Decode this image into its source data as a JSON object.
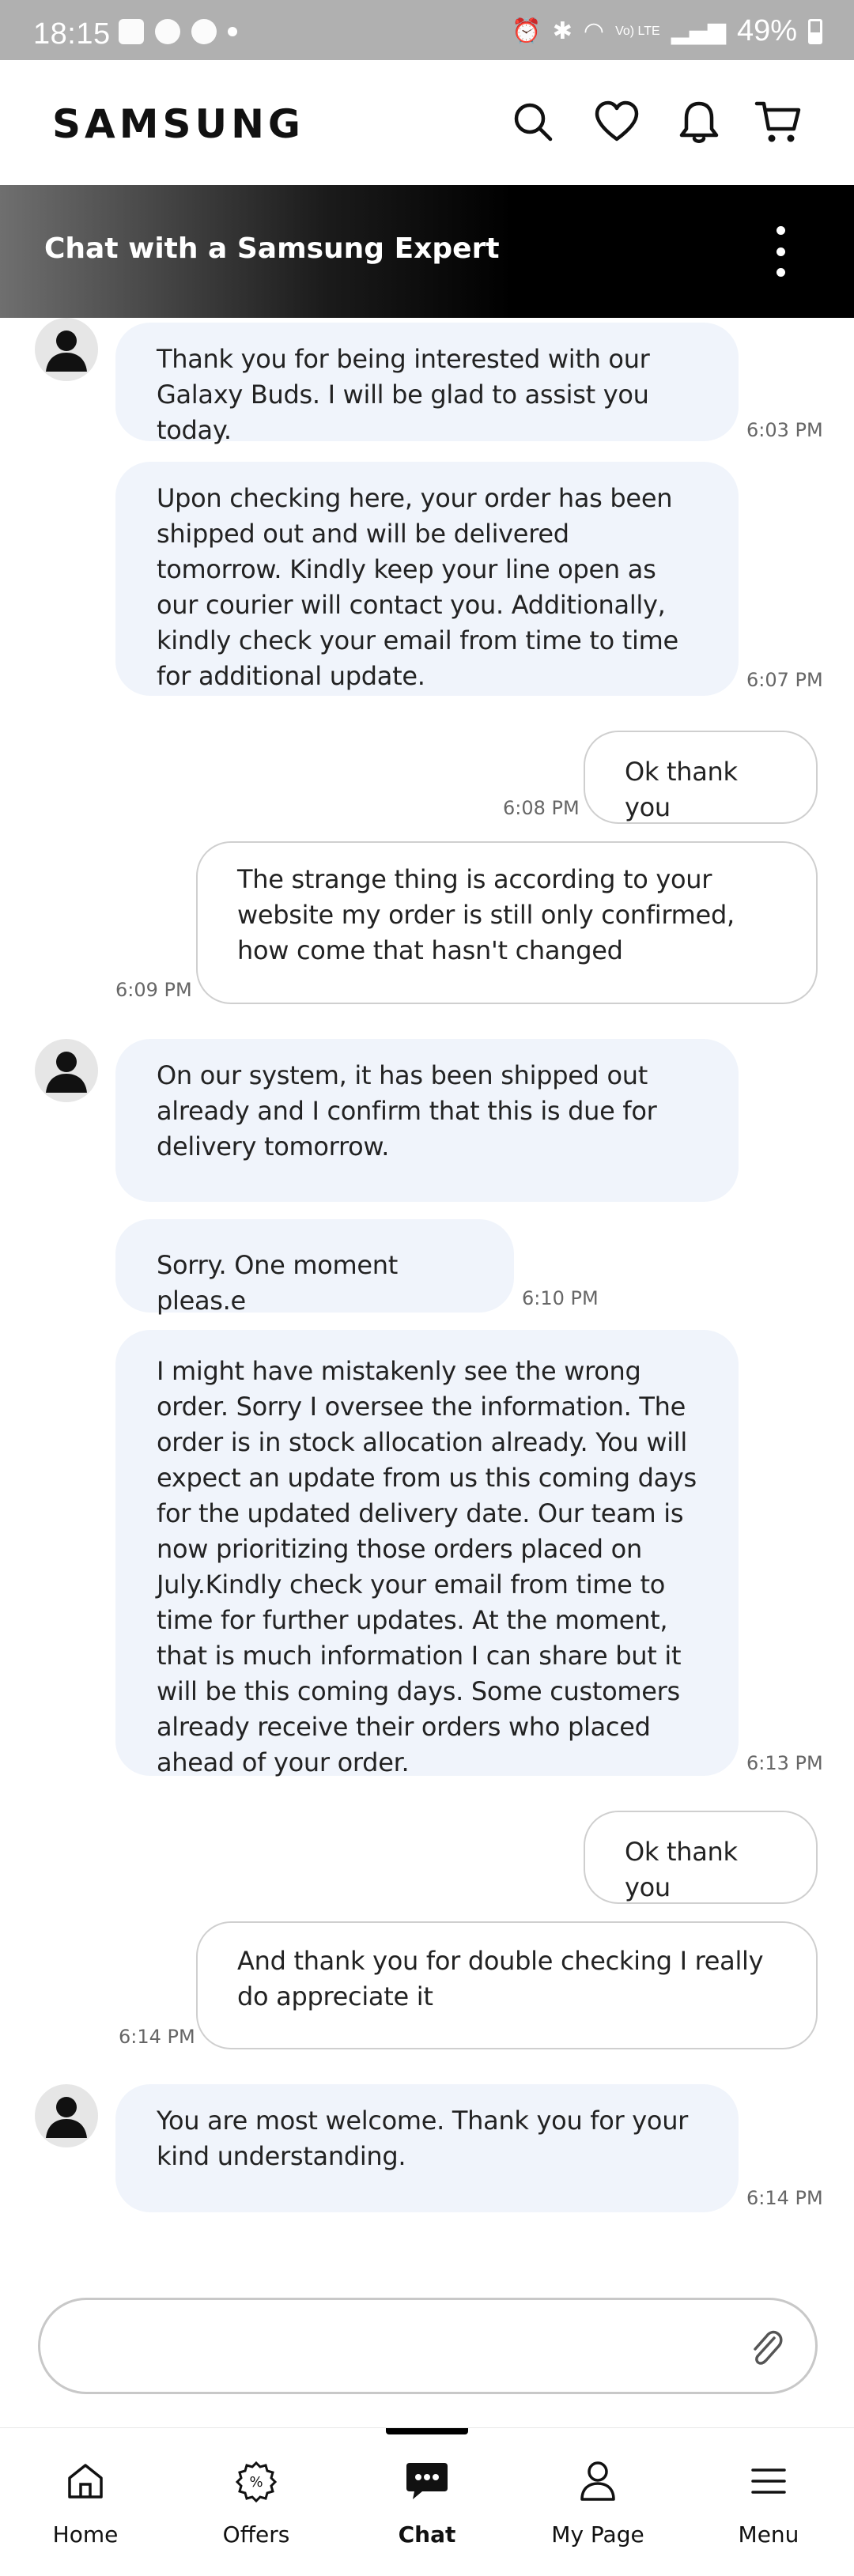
{
  "status_bar": {
    "time": "18:15",
    "network": "Vo) LTE",
    "battery": "49%"
  },
  "header": {
    "logo": "SAMSUNG"
  },
  "chat_banner": {
    "title": "Chat with a Samsung Expert"
  },
  "messages": [
    {
      "sender": "agent",
      "text": "Thank you for being interested with our Galaxy Buds. I will be glad to assist you today.",
      "time": "6:03 PM"
    },
    {
      "sender": "agent",
      "text": "Upon checking here, your order has been shipped out and will be delivered tomorrow. Kindly keep your line open as our courier will contact you. Additionally, kindly check your email from time to time for additional update.",
      "time": "6:07 PM"
    },
    {
      "sender": "user",
      "text": "Ok thank you",
      "time": "6:08 PM"
    },
    {
      "sender": "user",
      "text": "The strange thing is according to your website my order is still only confirmed,  how come that hasn't changed",
      "time": "6:09 PM"
    },
    {
      "sender": "agent",
      "text": "On our system, it has been shipped out already and I confirm that this is due for delivery tomorrow.",
      "time": ""
    },
    {
      "sender": "agent",
      "text": "Sorry. One moment pleas.e",
      "time": "6:10 PM"
    },
    {
      "sender": "agent",
      "text": "I might have mistakenly see the wrong order. Sorry I oversee the information. The order is in stock allocation already. You will expect an update from us this coming days for the updated delivery date. Our team is now prioritizing those orders placed on July.Kindly check your email from time to time for further updates. At the moment, that is much information I can share but it will be this coming days. Some customers already receive their orders who placed ahead of your order.",
      "time": "6:13 PM"
    },
    {
      "sender": "user",
      "text": "Ok thank you",
      "time": ""
    },
    {
      "sender": "user",
      "text": "And thank you for double checking I really do appreciate it",
      "time": "6:14 PM"
    },
    {
      "sender": "agent",
      "text": "You are most welcome. Thank you for your kind understanding.",
      "time": "6:14 PM"
    }
  ],
  "input": {
    "value": "",
    "placeholder": ""
  },
  "bottom_nav": [
    {
      "label": "Home",
      "icon": "home-icon"
    },
    {
      "label": "Offers",
      "icon": "offers-icon"
    },
    {
      "label": "Chat",
      "icon": "chat-icon",
      "active": true
    },
    {
      "label": "My Page",
      "icon": "person-icon"
    },
    {
      "label": "Menu",
      "icon": "menu-icon"
    }
  ]
}
